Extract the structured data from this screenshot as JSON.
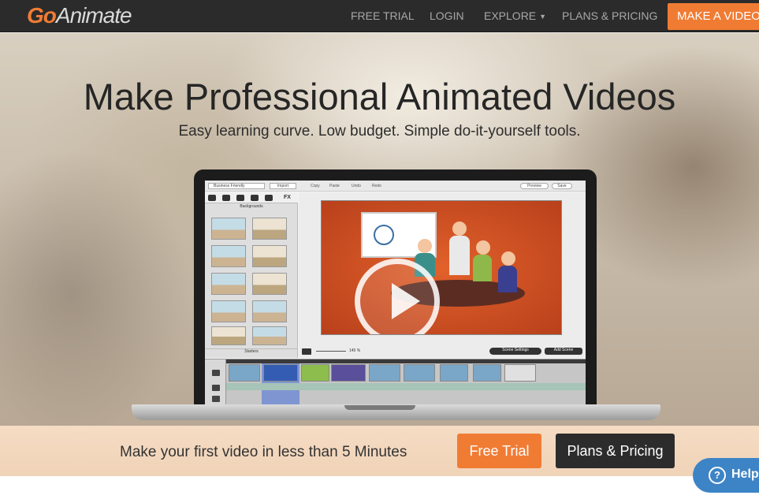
{
  "brand": {
    "logo_go": "Go",
    "logo_rest": "Animate"
  },
  "nav": {
    "free_trial": "FREE TRIAL",
    "login": "LOGIN",
    "explore": "EXPLORE",
    "plans": "PLANS & PRICING",
    "make_video": "MAKE A VIDEO"
  },
  "hero": {
    "title": "Make Professional Animated Videos",
    "subtitle": "Easy learning curve. Low budget. Simple do-it-yourself tools."
  },
  "editor": {
    "theme": "Business Friendly",
    "import": "Import",
    "copy": "Copy",
    "paste": "Paste",
    "undo": "Undo",
    "redo": "Redo",
    "preview": "Preview",
    "save": "Save",
    "fx": "FX",
    "backgrounds": "Backgrounds",
    "starters": "Starters",
    "zoom": "145 %",
    "scene_settings": "Scene Settings",
    "add_scene": "Add Scene"
  },
  "cta": {
    "text": "Make your first video in less than 5 Minutes",
    "free_trial": "Free Trial",
    "plans": "Plans & Pricing"
  },
  "help": {
    "label": "Help"
  },
  "colors": {
    "accent": "#f07c34",
    "dark": "#2b2b2b",
    "help": "#3d84c6"
  }
}
